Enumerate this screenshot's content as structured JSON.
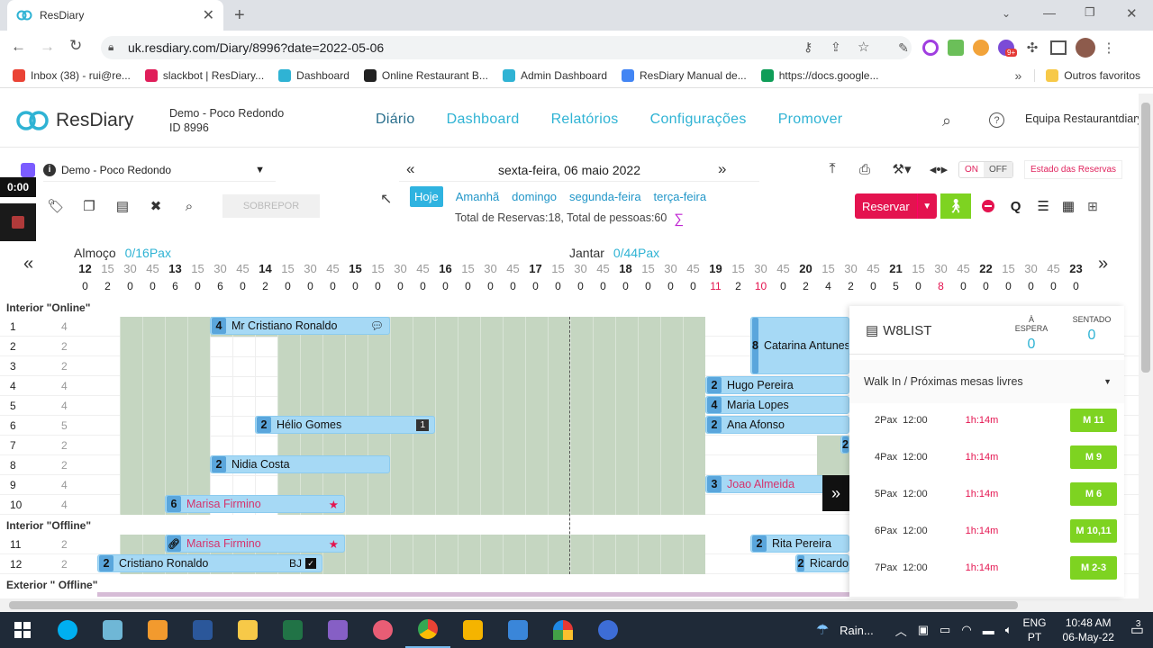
{
  "browser": {
    "tab_title": "ResDiary",
    "url": "uk.resdiary.com/Diary/8996?date=2022-05-06",
    "bookmarks": [
      {
        "label": "Inbox (38) - rui@re...",
        "color": "#ea4335"
      },
      {
        "label": "slackbot | ResDiary...",
        "color": "#e01e5a"
      },
      {
        "label": "Dashboard",
        "color": "#2fb3d4"
      },
      {
        "label": "Online Restaurant B...",
        "color": "#222222"
      },
      {
        "label": "Admin Dashboard",
        "color": "#2fb3d4"
      },
      {
        "label": "ResDiary Manual de...",
        "color": "#4285f4"
      },
      {
        "label": "https://docs.google...",
        "color": "#0f9d58"
      }
    ],
    "other_bookmarks": "Outros favoritos",
    "ext_badge": "9+"
  },
  "app": {
    "logo": "ResDiary",
    "venue_name": "Demo - Poco Redondo",
    "venue_id": "ID 8996",
    "nav": [
      "Diário",
      "Dashboard",
      "Relatórios",
      "Configurações",
      "Promover"
    ],
    "user": "Equipa Restaurantdiary"
  },
  "toolbar": {
    "venue_select": "Demo - Poco Redondo",
    "timer": "0:00",
    "sobrepor": "SOBREPOR",
    "date": "sexta-feira, 06 maio 2022",
    "quick_dates": [
      "Hoje",
      "Amanhã",
      "domingo",
      "segunda-feira",
      "terça-feira"
    ],
    "totals": "Total de Reservas:18, Total de pessoas:60",
    "sigma": "∑",
    "toggle_on": "ON",
    "toggle_off": "OFF",
    "estado": "Estado das Reservas",
    "reservar": "Reservar",
    "q": "Q"
  },
  "timeline": {
    "lunch_label": "Almoço",
    "lunch_pax": "0/16Pax",
    "dinner_label": "Jantar",
    "dinner_pax": "0/44Pax",
    "slots": [
      "12",
      "15",
      "30",
      "45",
      "13",
      "15",
      "30",
      "45",
      "14",
      "15",
      "30",
      "45",
      "15",
      "15",
      "30",
      "45",
      "16",
      "15",
      "30",
      "45",
      "17",
      "15",
      "30",
      "45",
      "18",
      "15",
      "30",
      "45",
      "19",
      "15",
      "30",
      "45",
      "20",
      "15",
      "30",
      "45",
      "21",
      "15",
      "30",
      "45",
      "22",
      "15",
      "30",
      "45",
      "23"
    ],
    "counts": [
      "0",
      "2",
      "0",
      "0",
      "6",
      "0",
      "6",
      "0",
      "2",
      "0",
      "0",
      "0",
      "0",
      "0",
      "0",
      "0",
      "0",
      "0",
      "0",
      "0",
      "0",
      "0",
      "0",
      "0",
      "0",
      "0",
      "0",
      "0",
      "11",
      "2",
      "10",
      "0",
      "2",
      "4",
      "2",
      "0",
      "5",
      "0",
      "8",
      "0",
      "0",
      "0",
      "0",
      "0",
      "0"
    ],
    "red_counts": [
      28,
      30,
      38
    ]
  },
  "sections": [
    {
      "name": "Interior \"Online\"",
      "tables": [
        {
          "num": "1",
          "cap": "4"
        },
        {
          "num": "2",
          "cap": "2"
        },
        {
          "num": "3",
          "cap": "2"
        },
        {
          "num": "4",
          "cap": "4"
        },
        {
          "num": "5",
          "cap": "4"
        },
        {
          "num": "6",
          "cap": "5"
        },
        {
          "num": "7",
          "cap": "2"
        },
        {
          "num": "8",
          "cap": "2"
        },
        {
          "num": "9",
          "cap": "4"
        },
        {
          "num": "10",
          "cap": "4"
        }
      ]
    },
    {
      "name": "Interior \"Offline\"",
      "tables": [
        {
          "num": "11",
          "cap": "2"
        },
        {
          "num": "12",
          "cap": "2"
        }
      ]
    },
    {
      "name": "Exterior \" Offline\"",
      "tables": []
    }
  ],
  "bookings": [
    {
      "pax": "4",
      "name": "Mr Cristiano Ronaldo",
      "tag": ""
    },
    {
      "pax": "8",
      "name": "Catarina Antunes",
      "tag": ""
    },
    {
      "pax": "2",
      "name": "Hugo Pereira",
      "tag": ""
    },
    {
      "pax": "4",
      "name": "Maria Lopes",
      "tag": ""
    },
    {
      "pax": "2",
      "name": "Hélio Gomes",
      "tag": "1"
    },
    {
      "pax": "2",
      "name": "Ana Afonso",
      "tag": ""
    },
    {
      "pax": "2",
      "name": "Nidia Costa",
      "tag": ""
    },
    {
      "pax": "3",
      "name": "Joao Almeida",
      "tag": ""
    },
    {
      "pax": "6",
      "name": "Marisa Firmino",
      "tag": ""
    },
    {
      "pax": "",
      "name": "Marisa Firmino",
      "tag": ""
    },
    {
      "pax": "2",
      "name": "Rita Pereira",
      "tag": ""
    },
    {
      "pax": "2",
      "name": "Cristiano Ronaldo",
      "tag": "BJ"
    },
    {
      "pax": "2",
      "name": "Ricardo",
      "tag": ""
    },
    {
      "pax": "2",
      "name": "",
      "tag": ""
    }
  ],
  "waitlist": {
    "title": "W8LIST",
    "waiting_label": "À ESPERA",
    "waiting": "0",
    "seated_label": "SENTADO",
    "seated": "0",
    "dropdown": "Walk In / Próximas mesas livres",
    "rows": [
      {
        "pax": "2Pax",
        "time": "12:00",
        "dur": "1h:14m",
        "table": "M 11"
      },
      {
        "pax": "4Pax",
        "time": "12:00",
        "dur": "1h:14m",
        "table": "M 9"
      },
      {
        "pax": "5Pax",
        "time": "12:00",
        "dur": "1h:14m",
        "table": "M 6"
      },
      {
        "pax": "6Pax",
        "time": "12:00",
        "dur": "1h:14m",
        "table": "M 10,11"
      },
      {
        "pax": "7Pax",
        "time": "12:00",
        "dur": "1h:14m",
        "table": "M 2-3"
      }
    ]
  },
  "taskbar": {
    "weather": "Rain...",
    "lang1": "ENG",
    "lang2": "PT",
    "time": "10:48 AM",
    "date": "06-May-22",
    "notif": "3"
  }
}
